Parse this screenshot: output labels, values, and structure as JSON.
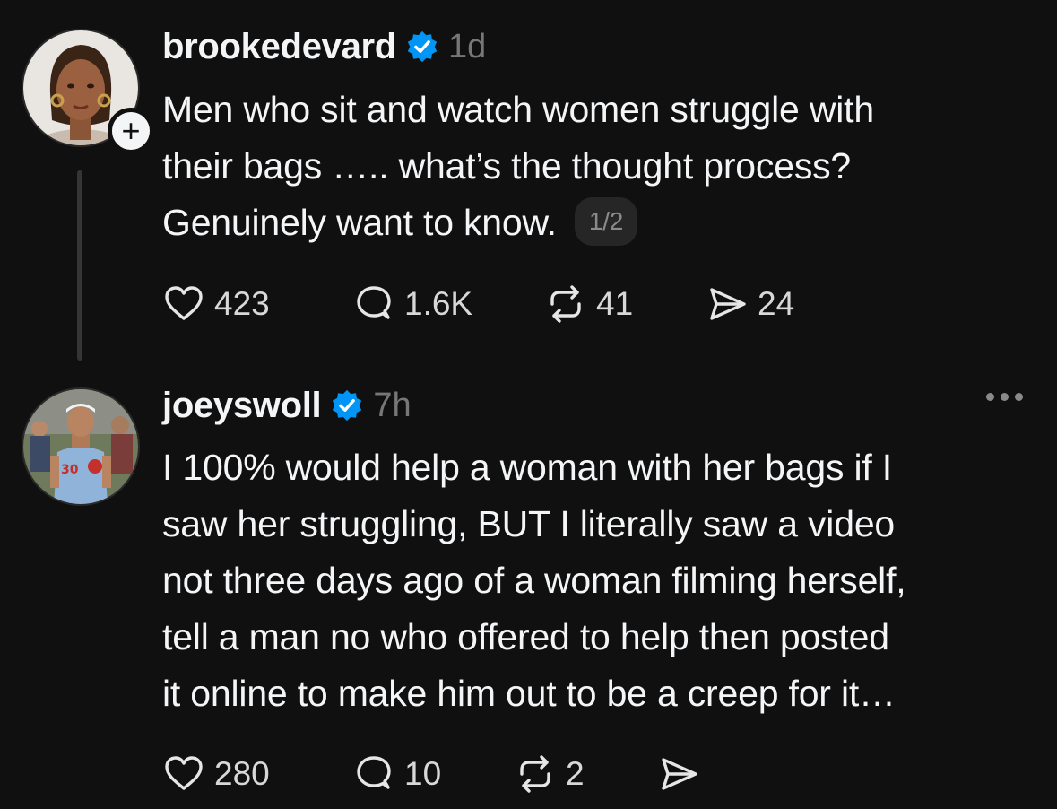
{
  "colors": {
    "background": "#101010",
    "text": "#f3f5f7",
    "muted": "#777777",
    "verified": "#0095f6"
  },
  "posts": [
    {
      "username": "brookedevard",
      "verified": true,
      "timestamp": "1d",
      "lines": [
        "Men who sit and watch women struggle with",
        "their bags ….. what’s the thought process?",
        "Genuinely want to know."
      ],
      "thread_position": "1/2",
      "follow_icon": "plus-icon",
      "stats": {
        "likes": "423",
        "replies": "1.6K",
        "reposts": "41",
        "shares": "24"
      }
    },
    {
      "username": "joeyswoll",
      "verified": true,
      "timestamp": "7h",
      "lines": [
        "I 100% would help a woman with her bags if I",
        "saw her struggling, BUT I literally saw a video",
        "not three days ago of a woman filming herself,",
        "tell a man no who offered to help then posted",
        "it online to make him out to be a creep for it…"
      ],
      "more_icon": "more-horizontal-icon",
      "stats": {
        "likes": "280",
        "replies": "10",
        "reposts": "2"
      }
    }
  ]
}
